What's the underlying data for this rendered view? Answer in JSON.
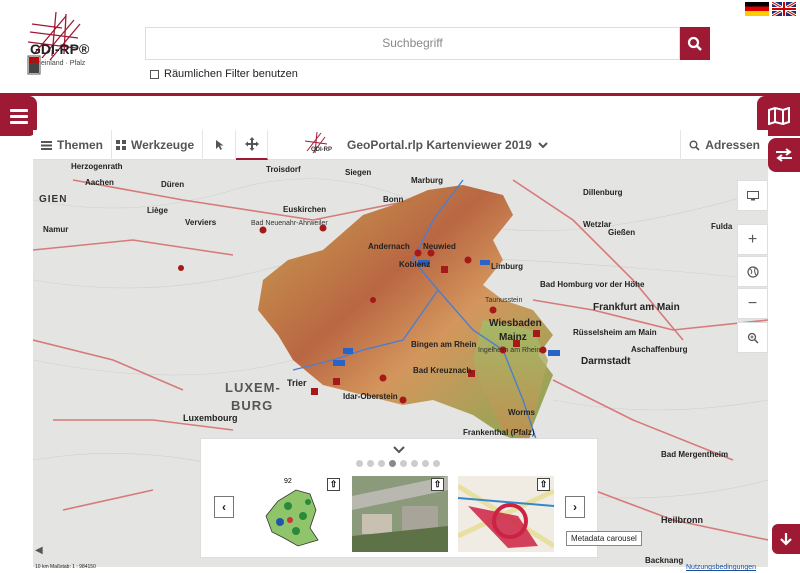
{
  "header": {
    "logo_text": "GDI-RP®",
    "logo_sub": "Rheinland · Pfalz",
    "search_placeholder": "Suchbegriff",
    "spatial_filter_label": "Räumlichen Filter benutzen"
  },
  "toolbar": {
    "themes_label": "Themen",
    "tools_label": "Werkzeuge",
    "title": "GeoPortal.rlp Kartenviewer 2019",
    "address_label": "Adressen"
  },
  "map": {
    "labels": {
      "aachen": "Aachen",
      "herzogenrath": "Herzogenrath",
      "duren": "Düren",
      "troisdorf": "Troisdorf",
      "siegen": "Siegen",
      "marburg": "Marburg",
      "bonn": "Bonn",
      "euskirchen": "Euskirchen",
      "liege": "Liège",
      "verviers": "Verviers",
      "koblenz": "Koblenz",
      "neuwied": "Neuwied",
      "andernach": "Andernach",
      "giessen": "Gießen",
      "wetzlar": "Wetzlar",
      "fulda": "Fulda",
      "namur": "Namur",
      "frankfurt": "Frankfurt am Main",
      "wiesbaden": "Wiesbaden",
      "mainz": "Mainz",
      "darmstadt": "Darmstadt",
      "aschaffenburg": "Aschaffenburg",
      "bingen": "Bingen am Rhein",
      "badkreuznach": "Bad Kreuznach",
      "trier": "Trier",
      "luxembourg_big": "LUXEM-",
      "luxembourg_big2": "BURG",
      "luxembourg": "Luxembourg",
      "idar": "Idar-Oberstein",
      "worms": "Worms",
      "frankenthal": "Frankenthal (Pfalz)",
      "ingelheim": "Ingelheim am Rhein",
      "heilbronn": "Heilbronn",
      "ruesselsheim": "Rüsselsheim am Main",
      "badhomburg": "Bad Homburg vor der Höhe",
      "badmergentheim": "Bad Mergentheim",
      "backnang": "Backnang",
      "gien": "GIEN",
      "badneuenahr": "Bad Neuenahr-Ahrweiler",
      "taunusstein": "Taunusstein",
      "dillenburg": "Dillenburg",
      "limburg": "Limburg"
    }
  },
  "carousel": {
    "tooltip": "Metadata carousel",
    "thumb1_label": "92"
  },
  "footer": {
    "scale": "10 km    Maßstab: 1 : 984150",
    "terms": "Nutzungsbedingungen"
  }
}
